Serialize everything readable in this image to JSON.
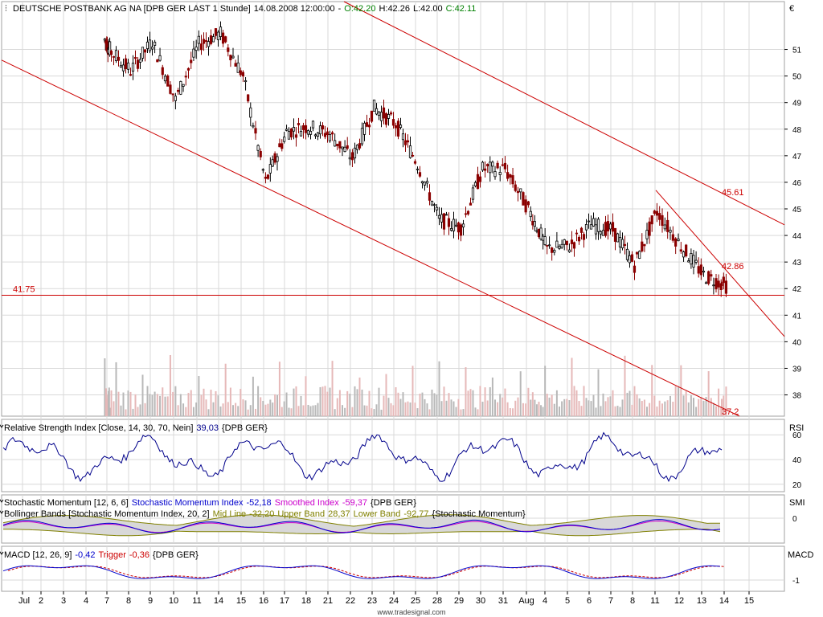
{
  "header": {
    "title": "DEUTSCHE POSTBANK AG NA [DPB GER LAST 1 Stunde]",
    "datetime": "14.08.2008 12:00:00",
    "open_label": "O:42.20",
    "high_label": "H:42.26",
    "low_label": "L:42.00",
    "close_label": "C:42.11",
    "currency": "€"
  },
  "colors": {
    "up": "#000000",
    "down": "#8b0000",
    "trendline": "#cc0000",
    "volume": "#b8b8b8",
    "volume_down": "#e6b8b8",
    "rsi_line": "#00008b",
    "smi_line": "#0000cc",
    "smi_smoothed": "#cc00cc",
    "bollinger_band_fill": "#d8d8d8",
    "bollinger_band_line": "#808000",
    "macd_line": "#0000cc",
    "macd_trigger": "#cc0000",
    "grid": "#d9d9d9"
  },
  "chart_data": [
    {
      "type": "candlestick",
      "title": "DEUTSCHE POSTBANK AG NA [DPB GER LAST 1 Stunde]",
      "ylabel": "€",
      "ylim": [
        37.2,
        52.8
      ],
      "y_ticks": [
        "51",
        "50",
        "49",
        "48",
        "47",
        "46",
        "45",
        "44",
        "43",
        "42",
        "41",
        "40",
        "39",
        "38"
      ],
      "x_ticks": [
        "Jul",
        "2",
        "3",
        "4",
        "7",
        "8",
        "9",
        "10",
        "11",
        "14",
        "15",
        "16",
        "17",
        "18",
        "21",
        "22",
        "23",
        "24",
        "25",
        "28",
        "29",
        "30",
        "31",
        "Aug",
        "4",
        "5",
        "6",
        "7",
        "8",
        "11",
        "12",
        "13",
        "14",
        "15"
      ],
      "ohlc_keypoints": [
        {
          "day": "7",
          "close": 51.0
        },
        {
          "day": "8",
          "close": 50.2
        },
        {
          "day": "9",
          "close": 51.3
        },
        {
          "day": "10",
          "close": 49.1
        },
        {
          "day": "11",
          "close": 51.2
        },
        {
          "day": "14",
          "close": 51.6
        },
        {
          "day": "15",
          "close": 50.0
        },
        {
          "day": "16",
          "close": 46.0
        },
        {
          "day": "17",
          "close": 47.9
        },
        {
          "day": "18",
          "close": 48.1
        },
        {
          "day": "21",
          "close": 47.8
        },
        {
          "day": "22",
          "close": 46.9
        },
        {
          "day": "23",
          "close": 48.8
        },
        {
          "day": "24",
          "close": 48.2
        },
        {
          "day": "25",
          "close": 46.7
        },
        {
          "day": "28",
          "close": 44.6
        },
        {
          "day": "29",
          "close": 44.3
        },
        {
          "day": "30",
          "close": 46.5
        },
        {
          "day": "31",
          "close": 46.5
        },
        {
          "day": "Aug",
          "close": 45.0
        },
        {
          "day": "4",
          "close": 43.5
        },
        {
          "day": "5",
          "close": 43.6
        },
        {
          "day": "6",
          "close": 44.4
        },
        {
          "day": "7",
          "close": 44.2
        },
        {
          "day": "8",
          "close": 42.9
        },
        {
          "day": "11",
          "close": 44.9
        },
        {
          "day": "12",
          "close": 43.6
        },
        {
          "day": "13",
          "close": 42.5
        },
        {
          "day": "14",
          "close": 42.11
        }
      ],
      "last": {
        "open": 42.2,
        "high": 42.26,
        "low": 42.0,
        "close": 42.11
      },
      "annotations": [
        {
          "label": "41.75",
          "value": 41.75
        },
        {
          "label": "45.61",
          "value": 45.61
        },
        {
          "label": "42.86",
          "value": 42.86
        },
        {
          "label": "37.2",
          "value": 37.2
        }
      ]
    },
    {
      "type": "line",
      "title": "Relative Strength Index [Close, 14, 30, 70, Nein]",
      "value_label": "39,03",
      "instrument": "{DPB GER}",
      "axis_label": "RSI",
      "ylim": [
        14,
        66
      ],
      "y_ticks": [
        "60",
        "40",
        "20"
      ]
    },
    {
      "type": "line",
      "title": "Stochastic Momentum [12, 6, 6]",
      "series": [
        {
          "name": "Stochastic Momentum Index",
          "value_label": "-52,18"
        },
        {
          "name": "Smoothed Index",
          "value_label": "-59,37"
        }
      ],
      "instrument": "{DPB GER}",
      "axis_label": "SMI",
      "y_ticks": [
        "0"
      ]
    },
    {
      "type": "area",
      "title": "Bollinger Bands [Stochastic Momentum Index, 20, 2]",
      "series": [
        {
          "name": "Mid Line",
          "value_label": "-32,20"
        },
        {
          "name": "Upper Band",
          "value_label": "28,37"
        },
        {
          "name": "Lower Band",
          "value_label": "-92,77"
        }
      ],
      "source": "{Stochastic Momentum}"
    },
    {
      "type": "line",
      "title": "MACD [12, 26, 9]",
      "series": [
        {
          "name": "MACD",
          "value_label": "-0,42"
        },
        {
          "name": "Trigger",
          "value_label": "-0,36"
        }
      ],
      "instrument": "{DPB GER}",
      "axis_label": "MACD",
      "y_ticks": [
        "-1"
      ]
    }
  ],
  "footer": {
    "watermark": "www.tradesignal.com"
  }
}
